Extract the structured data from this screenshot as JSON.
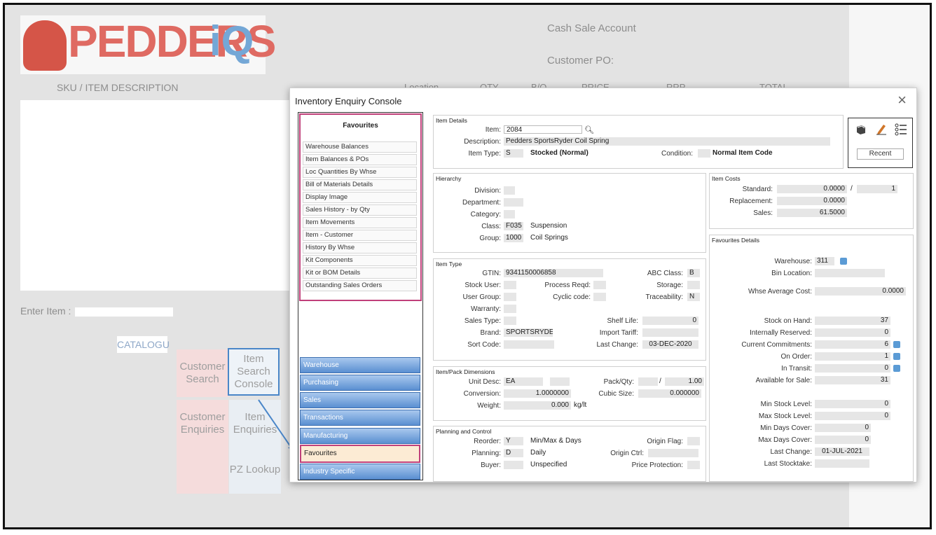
{
  "background": {
    "logo_text": "PEDDERS",
    "logo_suffix": "iQ",
    "account": "Cash Sale Account",
    "customer_po": "Customer PO:",
    "sku_header": "SKU / ITEM DESCRIPTION",
    "col_location": "Location",
    "col_qty": "QTY",
    "col_bo": "B/O",
    "col_price": "PRICE",
    "col_rrp": "RRP",
    "col_total": "TOTAL",
    "enter_item": "Enter Item :",
    "catalogue": "CATALOGU",
    "tiles": {
      "customer_search": "Customer Search",
      "item_search_console": "Item Search Console",
      "customer_enquiries": "Customer Enquiries",
      "item_enquiries": "Item Enquiries",
      "pz_lookup": "PZ Lookup"
    }
  },
  "dialog": {
    "title": "Inventory Enquiry Console",
    "close": "×",
    "favourites_heading": "Favourites",
    "favourites": [
      "Warehouse Balances",
      "Item Balances & POs",
      "Loc Quantities By Whse",
      "Bill of Materials Details",
      "Display Image",
      "Sales History - by Qty",
      "Item Movements",
      "Item - Customer",
      "History By Whse",
      "Kit Components",
      "Kit or BOM Details",
      "Outstanding Sales Orders"
    ],
    "nav": [
      "Warehouse",
      "Purchasing",
      "Sales",
      "Transactions",
      "Manufacturing",
      "Favourites",
      "Industry Specific"
    ],
    "recent": "Recent",
    "item_details": {
      "title": "Item Details",
      "item_label": "Item:",
      "item_value": "2084",
      "description_label": "Description:",
      "description_value": "Pedders SportsRyder Coil Spring",
      "item_type_label": "Item Type:",
      "item_type_code": "S",
      "item_type_desc": "Stocked (Normal)",
      "condition_label": "Condition:",
      "condition_desc": "Normal Item Code"
    },
    "hierarchy": {
      "title": "Hierarchy",
      "division": "Division:",
      "department": "Department:",
      "category": "Category:",
      "class_label": "Class:",
      "class_code": "F035",
      "class_desc": "Suspension",
      "group_label": "Group:",
      "group_code": "1000",
      "group_desc": "Coil Springs"
    },
    "item_type": {
      "title": "Item Type",
      "gtin_label": "GTIN:",
      "gtin": "9341150006858",
      "abc_label": "ABC Class:",
      "abc": "B",
      "stock_user": "Stock User:",
      "process_reqd": "Process Reqd:",
      "storage": "Storage:",
      "user_group": "User Group:",
      "cyclic_code": "Cyclic code:",
      "traceability_label": "Traceability:",
      "traceability": "N",
      "warranty": "Warranty:",
      "sales_type": "Sales Type:",
      "shelf_life_label": "Shelf Life:",
      "shelf_life": "0",
      "brand_label": "Brand:",
      "brand": "SPORTSRYDE",
      "import_tariff": "Import Tariff:",
      "sort_code": "Sort Code:",
      "last_change_label": "Last Change:",
      "last_change": "03-DEC-2020"
    },
    "dimensions": {
      "title": "Item/Pack Dimensions",
      "unit_desc_label": "Unit Desc:",
      "unit_desc": "EA",
      "pack_qty_label": "Pack/Qty:",
      "pack_sep": "/",
      "pack_qty": "1.00",
      "conversion_label": "Conversion:",
      "conversion": "1.0000000",
      "cubic_size_label": "Cubic Size:",
      "cubic_size": "0.000000",
      "weight_label": "Weight:",
      "weight": "0.000",
      "weight_unit": "kg/lt"
    },
    "planning": {
      "title": "Planning and Control",
      "reorder_label": "Reorder:",
      "reorder": "Y",
      "reorder_desc": "Min/Max & Days",
      "origin_flag": "Origin Flag:",
      "planning_label": "Planning:",
      "planning": "D",
      "planning_desc": "Daily",
      "origin_ctrl": "Origin Ctrl:",
      "buyer_label": "Buyer:",
      "buyer_desc": "Unspecified",
      "price_protection": "Price Protection:"
    },
    "costs": {
      "title": "Item Costs",
      "standard_label": "Standard:",
      "standard": "0.0000",
      "standard_sep": "/",
      "standard_qty": "1",
      "replacement_label": "Replacement:",
      "replacement": "0.0000",
      "sales_label": "Sales:",
      "sales": "61.5000"
    },
    "fav_details": {
      "title": "Favourites Details",
      "warehouse_label": "Warehouse:",
      "warehouse": "311",
      "bin_location": "Bin Location:",
      "whse_avg_cost_label": "Whse Average Cost:",
      "whse_avg_cost": "0.0000",
      "stock_on_hand_label": "Stock on Hand:",
      "stock_on_hand": "37",
      "internally_reserved_label": "Internally Reserved:",
      "internally_reserved": "0",
      "current_commitments_label": "Current Commitments:",
      "current_commitments": "6",
      "on_order_label": "On Order:",
      "on_order": "1",
      "in_transit_label": "In Transit:",
      "in_transit": "0",
      "available_label": "Available for Sale:",
      "available": "31",
      "min_stock_label": "Min Stock Level:",
      "min_stock": "0",
      "max_stock_label": "Max Stock Level:",
      "max_stock": "0",
      "min_days_label": "Min Days Cover:",
      "min_days": "0",
      "max_days_label": "Max Days Cover:",
      "max_days": "0",
      "last_change_label": "Last Change:",
      "last_change": "01-JUL-2021",
      "last_stocktake": "Last Stocktake:"
    }
  }
}
